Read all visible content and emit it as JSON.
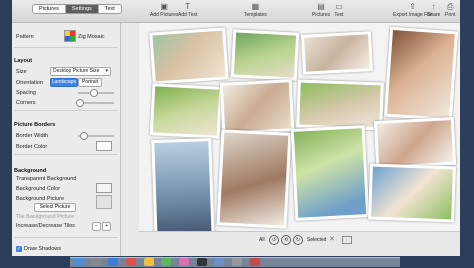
{
  "tabs": [
    "Pictures",
    "Settings",
    "Text"
  ],
  "toolbar": {
    "add_pictures": "Add Pictures",
    "add_text": "Add Text",
    "templates": "Templates",
    "pictures": "Pictures",
    "text": "Text",
    "export": "Export Image File",
    "share": "Share",
    "print": "Print"
  },
  "sidebar": {
    "pattern_label": "Pattern",
    "pattern_value": "Zig Mosaic",
    "layout_header": "Layout",
    "size_label": "Size",
    "size_value": "Desktop Picture Size",
    "orientation_label": "Orientation",
    "orientation_landscape": "Landscape",
    "orientation_portrait": "Portrait",
    "spacing_label": "Spacing",
    "spacing_value": 0.35,
    "corners_label": "Corners",
    "corners_value": 0.0,
    "borders_header": "Picture Borders",
    "border_width_label": "Border Width",
    "border_width_value": 0.1,
    "border_color_label": "Border Color",
    "background_header": "Background",
    "transparent_bg": "Transparent Background",
    "bg_color_label": "Background Color",
    "bg_picture_label": "Background Picture",
    "select_picture": "Select Picture",
    "tile_bg": "Tile Background Picture",
    "inc_dec_tiles": "Increase/Decrease Tiles",
    "draw_shadows": "Draw Shadows"
  },
  "bottom": {
    "all_label": "All",
    "selected_label": "Selected"
  },
  "colors": {
    "selected_tab": "#5e5e5e",
    "orientation_on": "#3d84e6",
    "canvas_bg": "#f3f3f3"
  }
}
